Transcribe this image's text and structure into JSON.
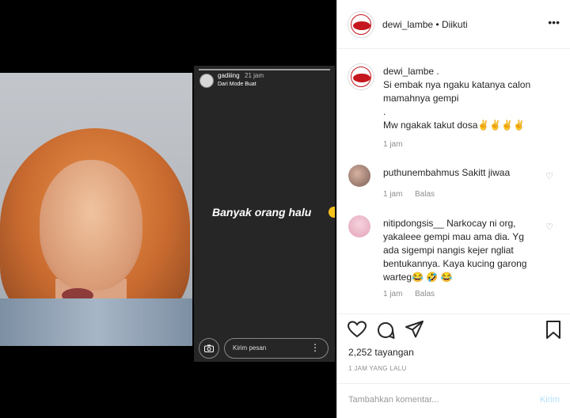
{
  "story": {
    "user": "gadiiing",
    "time": "21 jam",
    "subtitle": "Dari Mode Buat",
    "text": "Banyak orang halu",
    "message_placeholder": "Kirim pesan"
  },
  "post": {
    "author": "dewi_lambe",
    "follow_status": "Diikuti",
    "caption_user": "dewi_lambe .",
    "caption_lines": [
      "Si embak nya ngaku katanya calon",
      "mamahnya gempi",
      ".",
      "Mw ngakak takut dosa✌✌✌✌"
    ],
    "caption_time": "1 jam"
  },
  "comments": [
    {
      "user": "puthunembahmus",
      "lines": [
        "Sakitt jiwaa"
      ],
      "time": "1 jam",
      "reply": "Balas"
    },
    {
      "user": "nitipdongsis__",
      "lines": [
        "Narkocay ni org,",
        "yakaleee gempi mau ama dia. Yg",
        "ada sigempi nangis kejer ngliat",
        "bentukannya. Kaya kucing garong",
        "warteg😂 🤣 😂"
      ],
      "time": "1 jam",
      "reply": "Balas"
    }
  ],
  "stats": {
    "views": "2,252 tayangan",
    "posted_ago": "1 JAM YANG LALU"
  },
  "add_comment": {
    "placeholder": "Tambahkan komentar...",
    "button": "Kirim"
  },
  "icons": [
    "heart-icon",
    "comment-icon",
    "share-icon",
    "bookmark-icon",
    "more-icon",
    "camera-icon"
  ],
  "colors": {
    "brand_red": "#c4161c",
    "link_disabled": "#b2dffc",
    "meta_gray": "#8e8e8e"
  }
}
